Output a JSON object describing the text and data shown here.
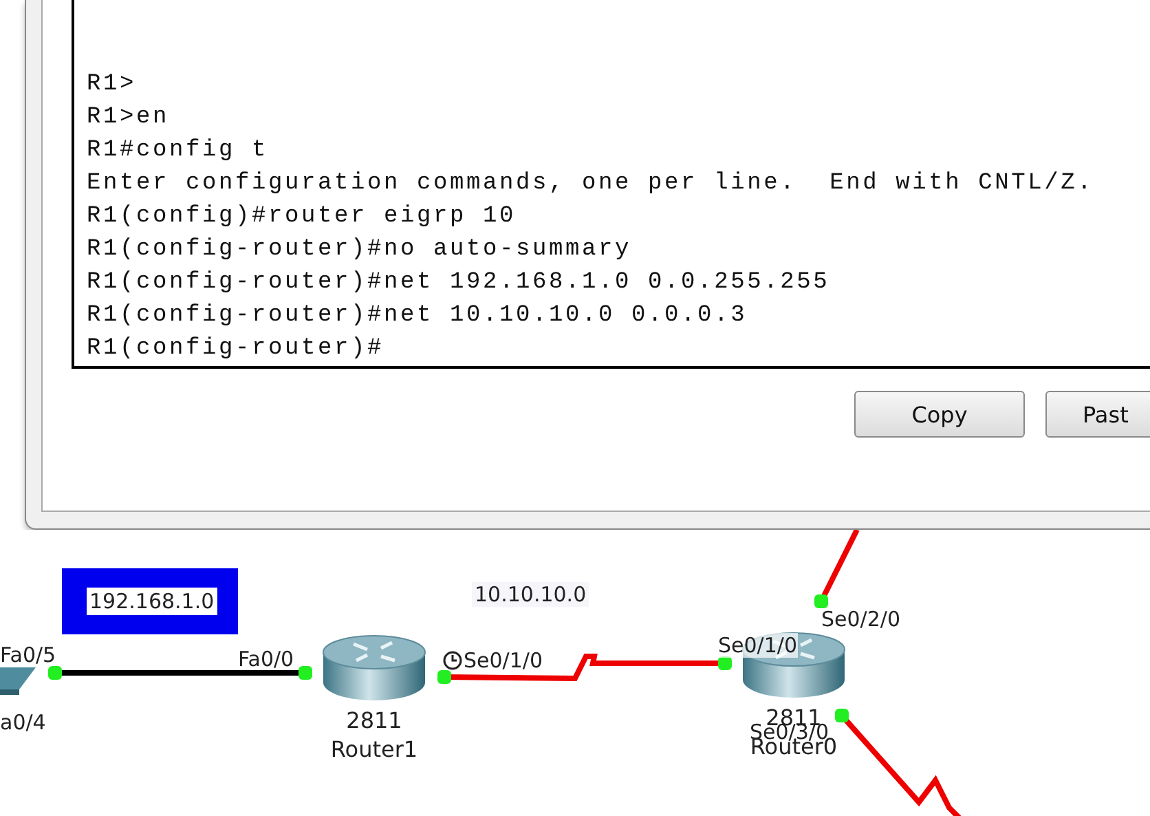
{
  "terminal": {
    "lines": [
      "R1>",
      "R1>en",
      "R1#config t",
      "Enter configuration commands, one per line.  End with CNTL/Z.",
      "R1(config)#router eigrp 10",
      "R1(config-router)#no auto-summary",
      "R1(config-router)#net 192.168.1.0 0.0.255.255",
      "R1(config-router)#net 10.10.10.0 0.0.0.3",
      "R1(config-router)#"
    ]
  },
  "buttons": [
    {
      "label": "Copy"
    },
    {
      "label": "Past"
    }
  ],
  "topology": {
    "networks": [
      {
        "label": "192.168.1.0",
        "highlighted": true
      },
      {
        "label": "10.10.10.0",
        "highlighted": false
      }
    ],
    "devices": [
      {
        "kind": "switch"
      },
      {
        "kind": "router",
        "model": "2811",
        "name": "Router1"
      },
      {
        "kind": "router",
        "model": "2811",
        "name": "Router0"
      }
    ],
    "ports": [
      {
        "label": "Fa0/5",
        "up": true,
        "clock": false
      },
      {
        "label": "a0/4",
        "clock": false
      },
      {
        "label": "Fa0/0",
        "up": true,
        "clock": false
      },
      {
        "label": "Se0/1/0",
        "up": true,
        "clock": true
      },
      {
        "label": "Se0/1/0",
        "up": true,
        "clock": false
      },
      {
        "label": "Se0/2/0",
        "up": true,
        "clock": false
      },
      {
        "label": "Se0/3/0",
        "up": true,
        "clock": false
      }
    ],
    "links": [
      {
        "kind": "ethernet"
      },
      {
        "kind": "serial"
      },
      {
        "kind": "serial"
      },
      {
        "kind": "serial"
      }
    ]
  }
}
